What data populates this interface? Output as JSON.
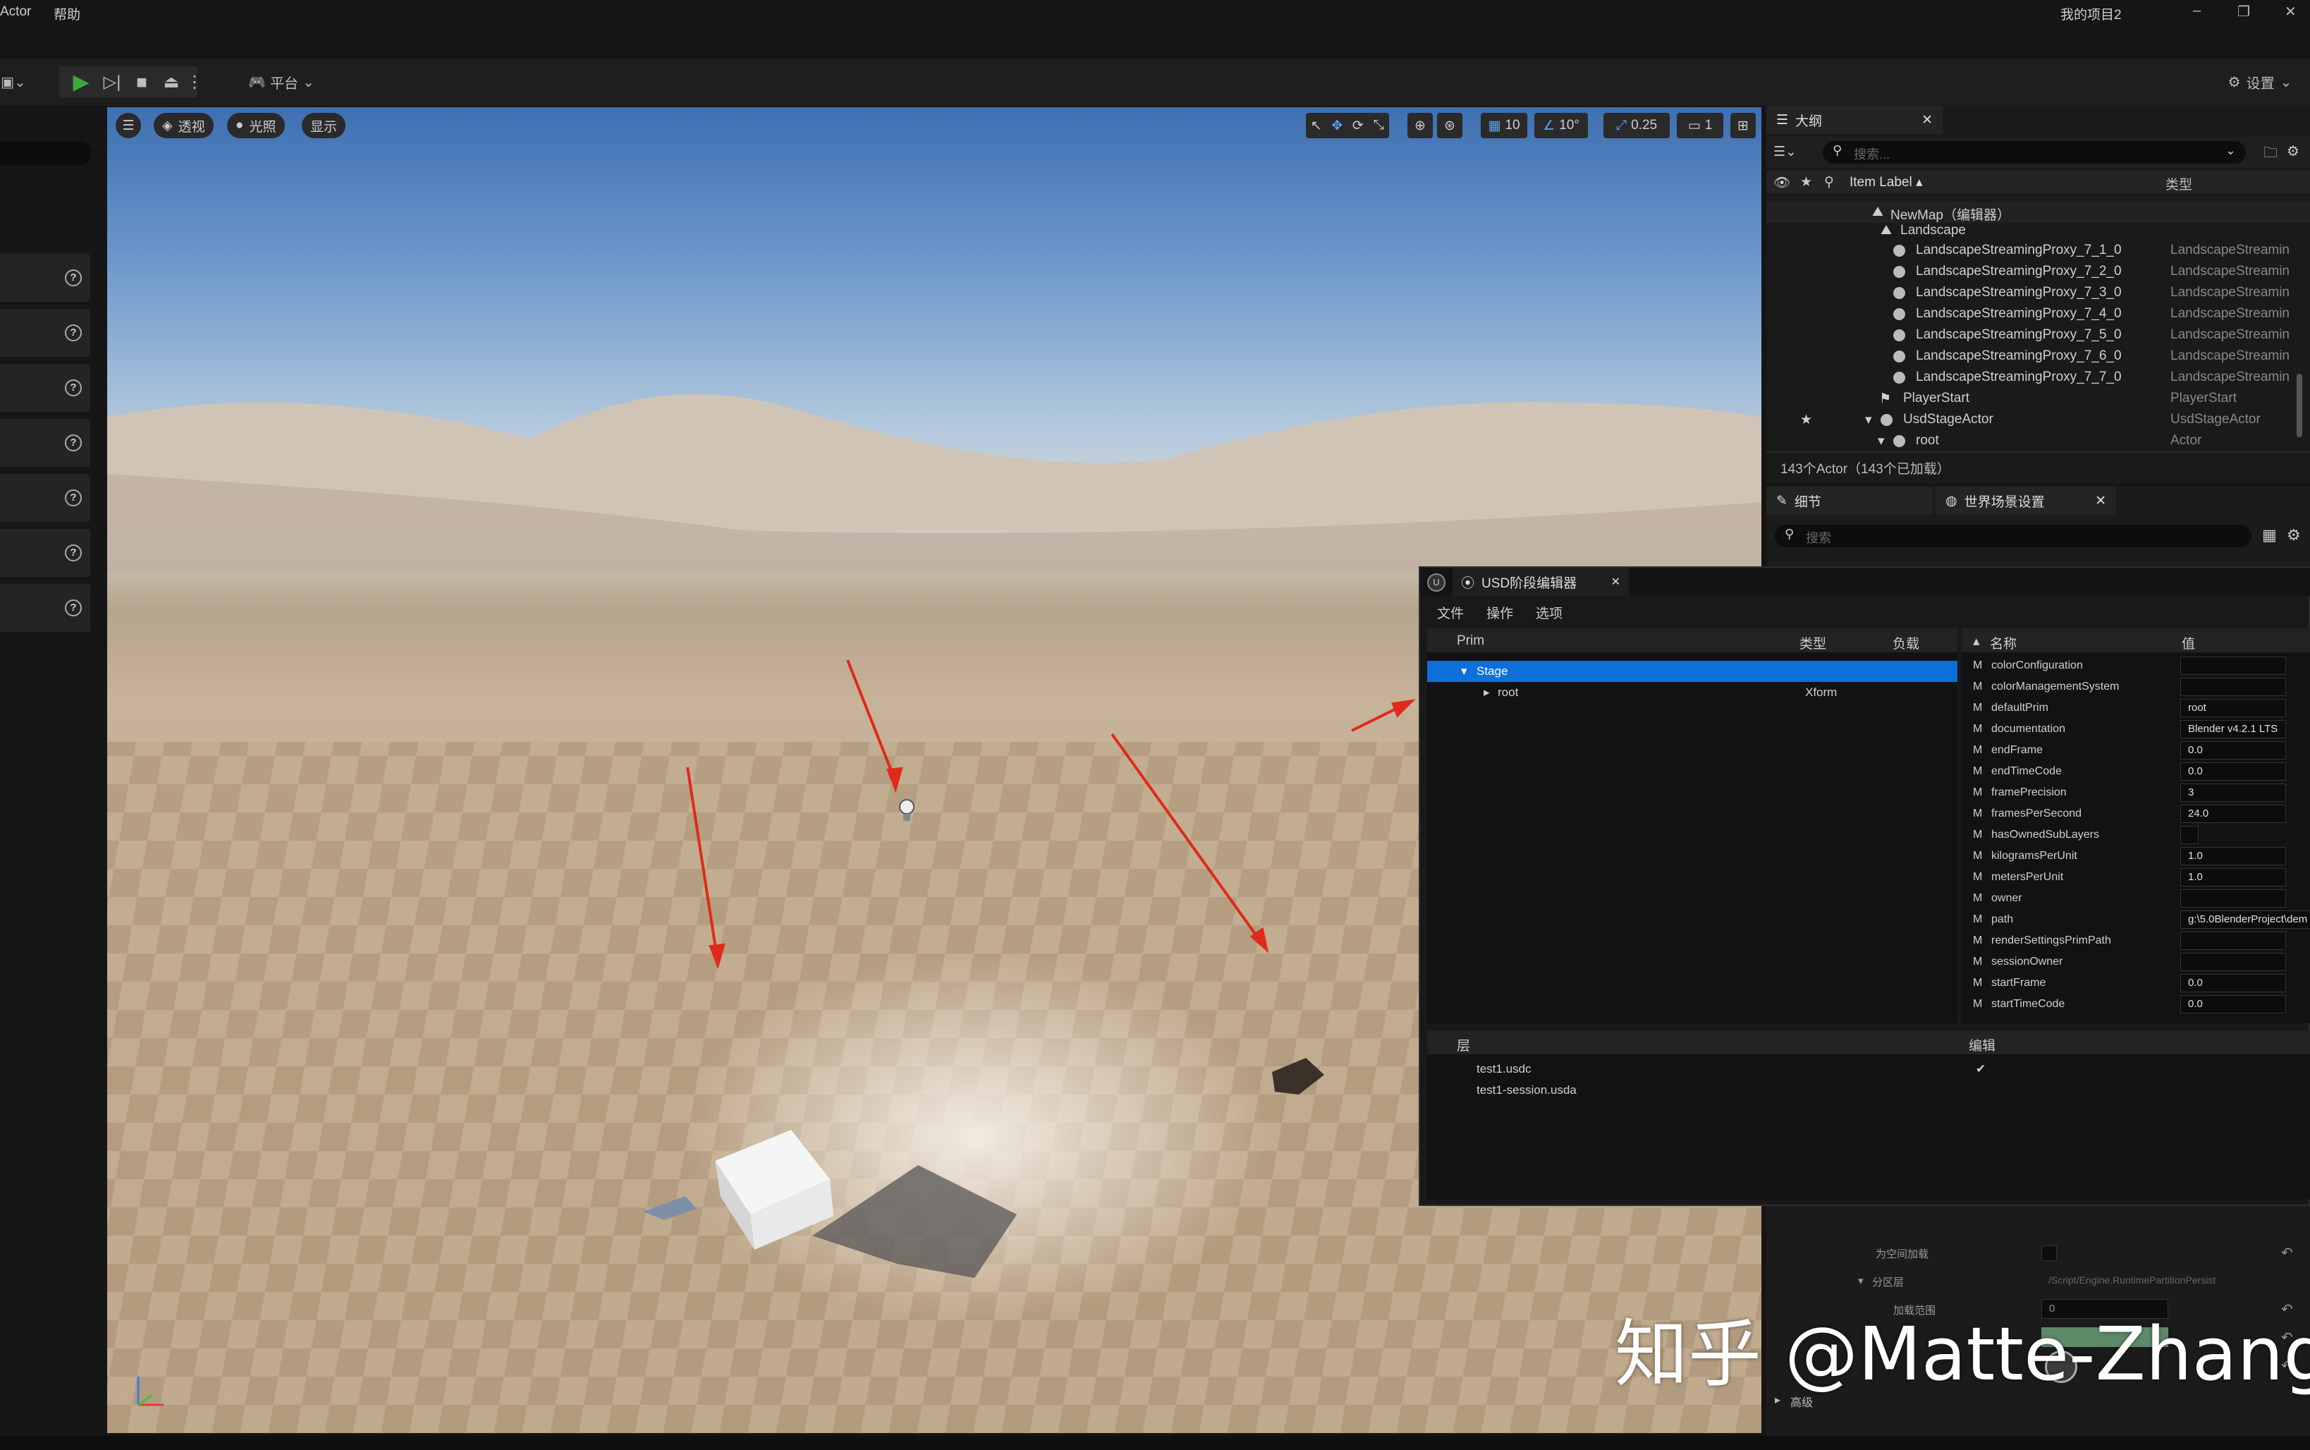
{
  "menubar": {
    "item_actor": "Actor",
    "item_help": "帮助",
    "project": "我的项目2"
  },
  "toolbar": {
    "platform": "平台",
    "settings": "设置"
  },
  "viewport": {
    "perspective": "透视",
    "lit": "光照",
    "show": "显示",
    "grid_snap": "10",
    "rot_snap": "10°",
    "scale_snap": "0.25",
    "camera_speed": "1"
  },
  "outliner": {
    "title": "大纲",
    "search_placeholder": "搜索...",
    "col_label": "Item Label ▴",
    "col_type": "类型",
    "map": "NewMap（编辑器）",
    "rows": [
      {
        "label": "Landscape",
        "type": ""
      },
      {
        "label": "LandscapeStreamingProxy_7_1_0",
        "type": "LandscapeStreamin"
      },
      {
        "label": "LandscapeStreamingProxy_7_2_0",
        "type": "LandscapeStreamin"
      },
      {
        "label": "LandscapeStreamingProxy_7_3_0",
        "type": "LandscapeStreamin"
      },
      {
        "label": "LandscapeStreamingProxy_7_4_0",
        "type": "LandscapeStreamin"
      },
      {
        "label": "LandscapeStreamingProxy_7_5_0",
        "type": "LandscapeStreamin"
      },
      {
        "label": "LandscapeStreamingProxy_7_6_0",
        "type": "LandscapeStreamin"
      },
      {
        "label": "LandscapeStreamingProxy_7_7_0",
        "type": "LandscapeStreamin"
      },
      {
        "label": "PlayerStart",
        "type": "PlayerStart"
      },
      {
        "label": "UsdStageActor",
        "type": "UsdStageActor"
      },
      {
        "label": "root",
        "type": "Actor"
      }
    ],
    "footer": "143个Actor（143个已加载）"
  },
  "details": {
    "tab_details": "细节",
    "tab_world": "世界场景设置",
    "search_placeholder": "搜索",
    "load_space": "为空间加载",
    "partition": "分区层",
    "partition_value": "/Script/Engine.RuntimePartitionPersist",
    "load_range": "加载范围",
    "load_range_value": "0",
    "advanced": "高级"
  },
  "usd": {
    "title": "USD阶段编辑器",
    "menu": [
      "文件",
      "操作",
      "选项"
    ],
    "col_prim": "Prim",
    "col_type": "类型",
    "col_load": "负载",
    "stage": "Stage",
    "root": "root",
    "root_type": "Xform",
    "col_name": "名称",
    "col_value": "值",
    "props": [
      {
        "m": "M",
        "name": "colorConfiguration",
        "value": ""
      },
      {
        "m": "M",
        "name": "colorManagementSystem",
        "value": ""
      },
      {
        "m": "M",
        "name": "defaultPrim",
        "value": "root"
      },
      {
        "m": "M",
        "name": "documentation",
        "value": "Blender v4.2.1 LTS"
      },
      {
        "m": "M",
        "name": "endFrame",
        "value": "0.0"
      },
      {
        "m": "M",
        "name": "endTimeCode",
        "value": "0.0"
      },
      {
        "m": "M",
        "name": "framePrecision",
        "value": "3"
      },
      {
        "m": "M",
        "name": "framesPerSecond",
        "value": "24.0"
      },
      {
        "m": "M",
        "name": "hasOwnedSubLayers",
        "value": ""
      },
      {
        "m": "M",
        "name": "kilogramsPerUnit",
        "value": "1.0"
      },
      {
        "m": "M",
        "name": "metersPerUnit",
        "value": "1.0"
      },
      {
        "m": "M",
        "name": "owner",
        "value": ""
      },
      {
        "m": "M",
        "name": "path",
        "value": "g:\\5.0BlenderProject\\dem"
      },
      {
        "m": "M",
        "name": "renderSettingsPrimPath",
        "value": ""
      },
      {
        "m": "M",
        "name": "sessionOwner",
        "value": ""
      },
      {
        "m": "M",
        "name": "startFrame",
        "value": "0.0"
      },
      {
        "m": "M",
        "name": "startTimeCode",
        "value": "0.0"
      }
    ],
    "col_layer": "层",
    "col_edit": "编辑",
    "layers": [
      {
        "name": "test1.usdc",
        "check": "✔"
      },
      {
        "name": "test1-session.usda",
        "check": ""
      }
    ]
  },
  "watermark": "知乎 @Matte-Zhang",
  "colors": {
    "selection": "#0d6fd8",
    "arrow": "#e02a1a",
    "play": "#3ea83e"
  }
}
